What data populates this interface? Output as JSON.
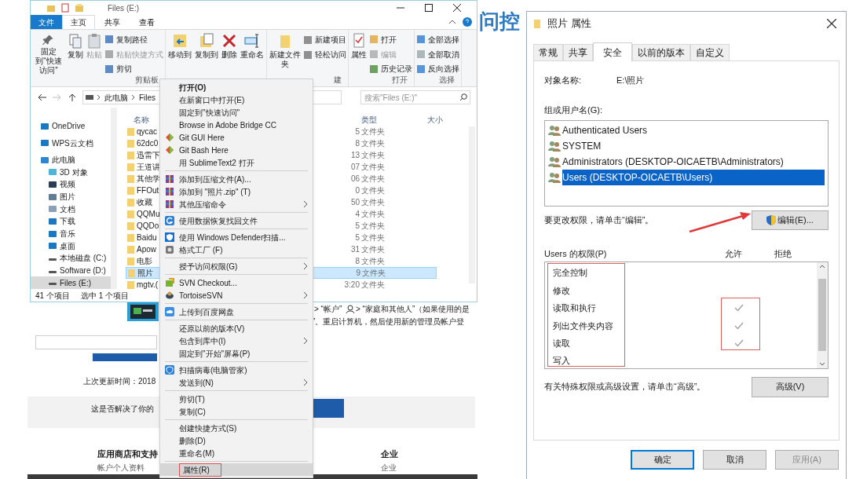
{
  "background_page": {
    "heading": "问控",
    "line_1": "> “帐户”",
    "line_1b": "> “家庭和其他人”（如果使用的是",
    "line_2": "”。重启计算机，然后使用新的管理员帐户登",
    "updated": "上次更新时间：2018",
    "feedback": "这是否解决了你的",
    "footer": [
      {
        "title": "应用商店和支持",
        "link": "帐户个人资料"
      },
      {
        "title": "企业",
        "link": "企业"
      }
    ]
  },
  "explorer": {
    "title": "Files (E:)",
    "tabs": [
      {
        "label": "文件",
        "kind": "file",
        "selected": false
      },
      {
        "label": "主页",
        "kind": "tab",
        "selected": true
      },
      {
        "label": "共享",
        "kind": "tab",
        "selected": false
      },
      {
        "label": "查看",
        "kind": "tab",
        "selected": false
      }
    ],
    "ribbon": [
      {
        "label": "剪贴板",
        "large": [
          {
            "label": "固定到“快速访问”",
            "kind": "pin",
            "disabled": false
          },
          {
            "label": "复制",
            "kind": "copy",
            "disabled": false
          },
          {
            "label": "粘贴",
            "kind": "paste",
            "disabled": true
          }
        ],
        "small": [
          {
            "label": "复制路径",
            "kind": "path",
            "disabled": false
          },
          {
            "label": "粘贴快捷方式",
            "kind": "shortcut",
            "disabled": true
          },
          {
            "label": "剪切",
            "kind": "cut",
            "disabled": false
          }
        ]
      },
      {
        "large": [
          {
            "label": "移动到",
            "kind": "move"
          },
          {
            "label": "复制到",
            "kind": "copyto"
          },
          {
            "label": "删除",
            "kind": "delete"
          },
          {
            "label": "重命名",
            "kind": "rename"
          }
        ]
      },
      {
        "label": "建",
        "large": [
          {
            "label": "新建文件夹",
            "kind": "folder"
          }
        ],
        "small": [
          {
            "label": "新建项目",
            "kind": "new",
            "disabled": false
          },
          {
            "label": "轻松访问",
            "kind": "easy",
            "disabled": false
          }
        ]
      },
      {
        "label": "打开",
        "large": [
          {
            "label": "属性",
            "kind": "props"
          }
        ],
        "small": [
          {
            "label": "打开",
            "kind": "open",
            "disabled": false
          },
          {
            "label": "编辑",
            "kind": "edit",
            "disabled": true
          },
          {
            "label": "历史记录",
            "kind": "history",
            "disabled": false
          }
        ]
      },
      {
        "label": "选择",
        "small": [
          {
            "label": "全部选择",
            "kind": "selall",
            "disabled": false
          },
          {
            "label": "全部取消",
            "kind": "selnone",
            "disabled": false
          },
          {
            "label": "反向选择",
            "kind": "selinv",
            "disabled": false
          }
        ]
      }
    ],
    "path": [
      "此电脑",
      "Files"
    ],
    "search_placeholder": "搜索\"Files (E:)\"",
    "nav": [
      {
        "label": "OneDrive",
        "kind": "cloud",
        "selected": false
      },
      {
        "label": "WPS云文档",
        "kind": "cloud2",
        "selected": false
      },
      {
        "label": "此电脑",
        "kind": "pc",
        "selected": false
      },
      {
        "label": "3D 对象",
        "kind": "cube",
        "selected": false
      },
      {
        "label": "视频",
        "kind": "video",
        "selected": false
      },
      {
        "label": "图片",
        "kind": "picture",
        "selected": false
      },
      {
        "label": "文档",
        "kind": "doc",
        "selected": false
      },
      {
        "label": "下载",
        "kind": "download",
        "selected": false
      },
      {
        "label": "音乐",
        "kind": "music",
        "selected": false
      },
      {
        "label": "桌面",
        "kind": "desktop",
        "selected": false
      },
      {
        "label": "本地磁盘 (C:)",
        "kind": "drive",
        "selected": false
      },
      {
        "label": "Software (D:)",
        "kind": "drive",
        "selected": false
      },
      {
        "label": "Files (E:)",
        "kind": "drive",
        "selected": true
      }
    ],
    "columns": [
      "名称",
      "类型",
      "大小"
    ],
    "rows": [
      {
        "name": "qycac",
        "date": "5",
        "type": "文件夹",
        "selected": false
      },
      {
        "name": "62dc0",
        "date": "8",
        "type": "文件夹",
        "selected": false
      },
      {
        "name": "迅雷下",
        "date": "13",
        "type": "文件夹",
        "selected": false
      },
      {
        "name": "王道讲",
        "date": "07",
        "type": "文件夹",
        "selected": false
      },
      {
        "name": "其他学",
        "date": "06",
        "type": "文件夹",
        "selected": false
      },
      {
        "name": "FFOut",
        "date": "0",
        "type": "文件夹",
        "selected": false
      },
      {
        "name": "收藏",
        "date": "50",
        "type": "文件夹",
        "selected": false
      },
      {
        "name": "QQMu",
        "date": "4",
        "type": "文件夹",
        "selected": false
      },
      {
        "name": "QQDo",
        "date": "5",
        "type": "文件夹",
        "selected": false
      },
      {
        "name": "Baidu",
        "date": "5",
        "type": "文件夹",
        "selected": false
      },
      {
        "name": "Apow",
        "date": "31",
        "type": "文件夹",
        "selected": false
      },
      {
        "name": "电影",
        "date": "8",
        "type": "文件夹",
        "selected": false
      },
      {
        "name": "照片",
        "date": "9",
        "type": "文件夹",
        "selected": true
      },
      {
        "name": "mgtv.(",
        "date": "3:20",
        "type": "文件夹",
        "selected": false
      }
    ],
    "status": [
      "41 个项目",
      "选中 1 个项目"
    ]
  },
  "context_menu": [
    [
      {
        "label": "打开(O)",
        "kind": "none",
        "default": true,
        "submenu": false,
        "highlighted": false
      },
      {
        "label": "在新窗口中打开(E)",
        "kind": "none",
        "default": false,
        "submenu": false,
        "highlighted": false
      },
      {
        "label": "固定到\"快速访问\"",
        "kind": "none",
        "default": false,
        "submenu": false,
        "highlighted": false
      },
      {
        "label": "Browse in Adobe Bridge CC",
        "kind": "none",
        "default": false,
        "submenu": false,
        "highlighted": false
      },
      {
        "label": "Git GUI Here",
        "kind": "git",
        "default": false,
        "submenu": false,
        "highlighted": false
      },
      {
        "label": "Git Bash Here",
        "kind": "git",
        "default": false,
        "submenu": false,
        "highlighted": false
      },
      {
        "label": "用 SublimeText2 打开",
        "kind": "none",
        "default": false,
        "submenu": false,
        "highlighted": false
      }
    ],
    [
      {
        "label": "添加到压缩文件(A)...",
        "kind": "archive",
        "default": false,
        "submenu": false,
        "highlighted": false
      },
      {
        "label": "添加到 \"照片.zip\" (T)",
        "kind": "archive",
        "default": false,
        "submenu": false,
        "highlighted": false
      },
      {
        "label": "其他压缩命令",
        "kind": "archive",
        "default": false,
        "submenu": true,
        "highlighted": false
      }
    ],
    [
      {
        "label": "使用数据恢复找回文件",
        "kind": "recover",
        "default": false,
        "submenu": false,
        "highlighted": false
      }
    ],
    [
      {
        "label": "使用 Windows Defender扫描...",
        "kind": "shield",
        "default": false,
        "submenu": false,
        "highlighted": false
      },
      {
        "label": "格式工厂 (F)",
        "kind": "format",
        "default": false,
        "submenu": false,
        "highlighted": false
      }
    ],
    [
      {
        "label": "授予访问权限(G)",
        "kind": "none",
        "default": false,
        "submenu": true,
        "highlighted": false
      }
    ],
    [
      {
        "label": "SVN Checkout...",
        "kind": "svn",
        "default": false,
        "submenu": false,
        "highlighted": false
      },
      {
        "label": "TortoiseSVN",
        "kind": "tortoise",
        "default": false,
        "submenu": true,
        "highlighted": false
      }
    ],
    [
      {
        "label": "上传到百度网盘",
        "kind": "cloud",
        "default": false,
        "submenu": false,
        "highlighted": false
      }
    ],
    [
      {
        "label": "还原以前的版本(V)",
        "kind": "none",
        "default": false,
        "submenu": false,
        "highlighted": false
      },
      {
        "label": "包含到库中(I)",
        "kind": "none",
        "default": false,
        "submenu": true,
        "highlighted": false
      },
      {
        "label": "固定到\"开始\"屏幕(P)",
        "kind": "none",
        "default": false,
        "submenu": false,
        "highlighted": false
      }
    ],
    [
      {
        "label": "扫描病毒(电脑管家)",
        "kind": "guard",
        "default": false,
        "submenu": false,
        "highlighted": false
      },
      {
        "label": "发送到(N)",
        "kind": "none",
        "default": false,
        "submenu": true,
        "highlighted": false
      }
    ],
    [
      {
        "label": "剪切(T)",
        "kind": "none",
        "default": false,
        "submenu": false,
        "highlighted": false
      },
      {
        "label": "复制(C)",
        "kind": "none",
        "default": false,
        "submenu": false,
        "highlighted": false
      }
    ],
    [
      {
        "label": "创建快捷方式(S)",
        "kind": "none",
        "default": false,
        "submenu": false,
        "highlighted": false
      },
      {
        "label": "删除(D)",
        "kind": "none",
        "default": false,
        "submenu": false,
        "highlighted": false
      },
      {
        "label": "重命名(M)",
        "kind": "none",
        "default": false,
        "submenu": false,
        "highlighted": false
      }
    ],
    [
      {
        "label": "属性(R)",
        "kind": "none",
        "default": false,
        "submenu": false,
        "highlighted": true
      }
    ]
  ],
  "dialog": {
    "title": "照片 属性",
    "tabs": [
      {
        "label": "常规",
        "selected": false
      },
      {
        "label": "共享",
        "selected": false
      },
      {
        "label": "安全",
        "selected": true
      },
      {
        "label": "以前的版本",
        "selected": false
      },
      {
        "label": "自定义",
        "selected": false
      }
    ],
    "object_label": "对象名称:",
    "object_value": "E:\\照片",
    "users_label": "组或用户名(G):",
    "users": [
      {
        "name": "Authenticated Users",
        "selected": false
      },
      {
        "name": "SYSTEM",
        "selected": false
      },
      {
        "name": "Administrators (DESKTOP-OICAETB\\Administrators)",
        "selected": false
      },
      {
        "name": "Users (DESKTOP-OICAETB\\Users)",
        "selected": true
      }
    ],
    "edit_hint": "要更改权限，请单击“编辑”。",
    "edit_button": "编辑(E)...",
    "perm_label": "Users 的权限(P)",
    "allow_label": "允许",
    "deny_label": "拒绝",
    "permissions": [
      {
        "name": "完全控制",
        "allow": false,
        "deny": false
      },
      {
        "name": "修改",
        "allow": false,
        "deny": false
      },
      {
        "name": "读取和执行",
        "allow": true,
        "deny": false
      },
      {
        "name": "列出文件夹内容",
        "allow": true,
        "deny": false
      },
      {
        "name": "读取",
        "allow": true,
        "deny": false
      },
      {
        "name": "写入",
        "allow": false,
        "deny": false
      }
    ],
    "advanced_hint": "有关特殊权限或高级设置，请单击“高级”。",
    "advanced_button": "高级(V)",
    "buttons": [
      {
        "label": "确定",
        "default": true,
        "disabled": false
      },
      {
        "label": "取消",
        "default": false,
        "disabled": false
      },
      {
        "label": "应用(A)",
        "default": false,
        "disabled": true
      }
    ]
  }
}
